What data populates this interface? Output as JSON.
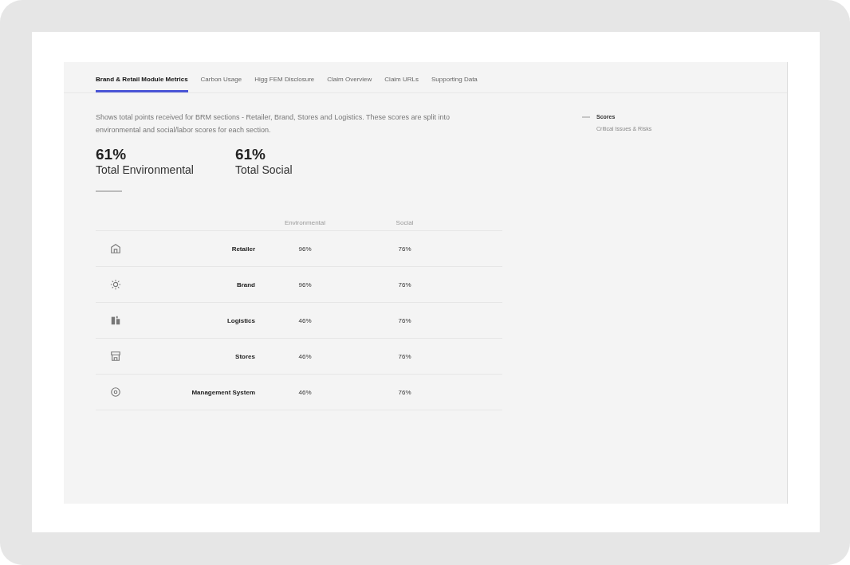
{
  "tabs": [
    {
      "label": "Brand & Retail Module Metrics",
      "selected": true
    },
    {
      "label": "Carbon Usage",
      "selected": false
    },
    {
      "label": "Higg FEM Disclosure",
      "selected": false
    },
    {
      "label": "Claim Overview",
      "selected": false
    },
    {
      "label": "Claim URLs",
      "selected": false
    },
    {
      "label": "Supporting Data",
      "selected": false
    }
  ],
  "description": "Shows total points received for BRM sections - Retailer, Brand, Stores and Logistics. These scores are split into environmental and social/labor scores for each section.",
  "totals": [
    {
      "value": "61%",
      "label": "Total Environmental"
    },
    {
      "value": "61%",
      "label": "Total Social"
    }
  ],
  "table": {
    "columns": [
      "Environmental",
      "Social"
    ],
    "rows": [
      {
        "kind": "retailer",
        "name": "Retailer",
        "environmental": "96%",
        "social": "76%"
      },
      {
        "kind": "brand",
        "name": "Brand",
        "environmental": "96%",
        "social": "76%"
      },
      {
        "kind": "logistics",
        "name": "Logistics",
        "environmental": "46%",
        "social": "76%"
      },
      {
        "kind": "stores",
        "name": "Stores",
        "environmental": "46%",
        "social": "76%"
      },
      {
        "kind": "management",
        "name": "Management System",
        "environmental": "46%",
        "social": "76%"
      }
    ]
  },
  "sidebar": {
    "title": "Scores",
    "items": [
      "Critical Issues & Risks"
    ]
  }
}
